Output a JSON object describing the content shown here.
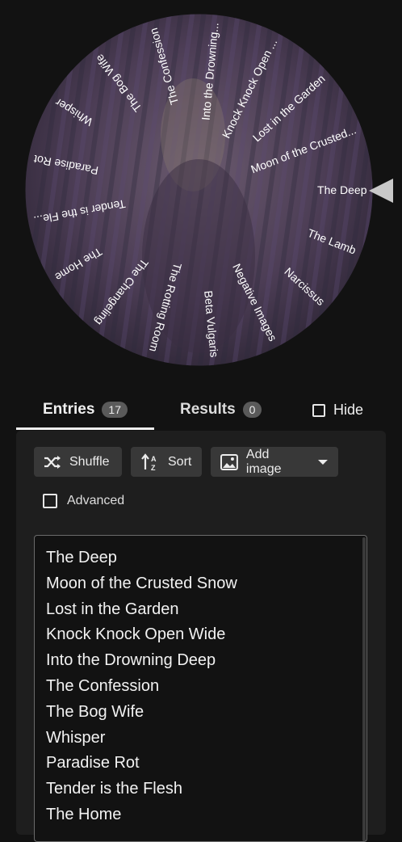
{
  "wheel": {
    "entries": [
      "The Deep",
      "Moon of the Crusted...",
      "Lost in the Garden",
      "Knock Knock Open ...",
      "Into the Drowning...",
      "The Confession",
      "The Bog Wife",
      "Whisper",
      "Paradise Rot",
      "Tender is the Fle...",
      "The Home",
      "The Changeling",
      "The Rotting Room",
      "Beta Vulgaris",
      "Negative Images",
      "Narcissus",
      "The Lamb"
    ],
    "colors": {
      "bark": "#4a3a52",
      "bark_light": "#7a6580",
      "stripe_a": "#5b4a72",
      "stripe_b": "#2e2a3c",
      "text": "#ffffff"
    }
  },
  "tabs": {
    "entries_label": "Entries",
    "entries_count": "17",
    "results_label": "Results",
    "results_count": "0",
    "hide_label": "Hide"
  },
  "toolbar": {
    "shuffle_label": "Shuffle",
    "sort_label": "Sort",
    "add_image_label": "Add image",
    "advanced_label": "Advanced"
  },
  "entries_text": [
    "The Deep",
    "Moon of the Crusted Snow",
    "Lost in the Garden",
    "Knock Knock Open Wide",
    "Into the Drowning Deep",
    "The Confession",
    "The Bog Wife",
    "Whisper",
    "Paradise Rot",
    "Tender is the Flesh",
    "The Home"
  ]
}
